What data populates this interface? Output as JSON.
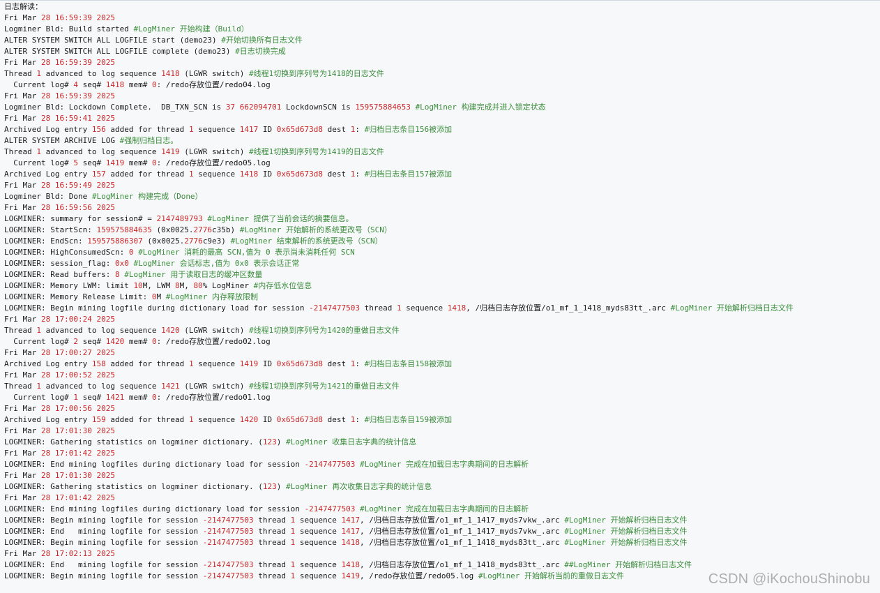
{
  "colors": {
    "background": "#f6f8fa",
    "text": "#1a1a1a",
    "number": "#c82829",
    "comment": "#3b8d3b"
  },
  "code": {
    "lines": [
      [
        {
          "t": "日志解读："
        }
      ],
      [
        {
          "t": "Fri Mar "
        },
        {
          "t": "28",
          "k": "n"
        },
        {
          "t": " "
        },
        {
          "t": "16:59:39 2025",
          "k": "n"
        }
      ],
      [
        {
          "t": "Logminer Bld: Build started "
        },
        {
          "t": "#LogMiner 开始构建（Build）",
          "k": "c"
        }
      ],
      [
        {
          "t": "ALTER SYSTEM SWITCH ALL LOGFILE start (demo23) "
        },
        {
          "t": "#开始切换所有日志文件",
          "k": "c"
        }
      ],
      [
        {
          "t": "ALTER SYSTEM SWITCH ALL LOGFILE complete (demo23) "
        },
        {
          "t": "#日志切换完成",
          "k": "c"
        }
      ],
      [
        {
          "t": "Fri Mar "
        },
        {
          "t": "28",
          "k": "n"
        },
        {
          "t": " "
        },
        {
          "t": "16:59:39 2025",
          "k": "n"
        }
      ],
      [
        {
          "t": "Thread "
        },
        {
          "t": "1",
          "k": "n"
        },
        {
          "t": " advanced to log sequence "
        },
        {
          "t": "1418",
          "k": "n"
        },
        {
          "t": " (LGWR switch) "
        },
        {
          "t": "#线程1切换到序列号为1418的日志文件",
          "k": "c"
        }
      ],
      [
        {
          "t": "  Current log# "
        },
        {
          "t": "4",
          "k": "n"
        },
        {
          "t": " seq# "
        },
        {
          "t": "1418",
          "k": "n"
        },
        {
          "t": " mem# "
        },
        {
          "t": "0",
          "k": "n"
        },
        {
          "t": ": /redo存放位置/redo04.log"
        }
      ],
      [
        {
          "t": "Fri Mar "
        },
        {
          "t": "28",
          "k": "n"
        },
        {
          "t": " "
        },
        {
          "t": "16:59:39 2025",
          "k": "n"
        }
      ],
      [
        {
          "t": "Logminer Bld: Lockdown Complete.  DB_TXN_SCN is "
        },
        {
          "t": "37",
          "k": "n"
        },
        {
          "t": " "
        },
        {
          "t": "662094701",
          "k": "n"
        },
        {
          "t": " LockdownSCN is "
        },
        {
          "t": "159575884653",
          "k": "n"
        },
        {
          "t": " "
        },
        {
          "t": "#LogMiner 构建完成并进入锁定状态",
          "k": "c"
        }
      ],
      [
        {
          "t": "Fri Mar "
        },
        {
          "t": "28",
          "k": "n"
        },
        {
          "t": " "
        },
        {
          "t": "16:59:41 2025",
          "k": "n"
        }
      ],
      [
        {
          "t": "Archived Log entry "
        },
        {
          "t": "156",
          "k": "n"
        },
        {
          "t": " added for thread "
        },
        {
          "t": "1",
          "k": "n"
        },
        {
          "t": " sequence "
        },
        {
          "t": "1417",
          "k": "n"
        },
        {
          "t": " ID "
        },
        {
          "t": "0x65d673d8",
          "k": "n"
        },
        {
          "t": " dest "
        },
        {
          "t": "1",
          "k": "n"
        },
        {
          "t": ": "
        },
        {
          "t": "#归档日志条目156被添加",
          "k": "c"
        }
      ],
      [
        {
          "t": "ALTER SYSTEM ARCHIVE LOG "
        },
        {
          "t": "#强制归档日志。",
          "k": "c"
        }
      ],
      [
        {
          "t": "Thread "
        },
        {
          "t": "1",
          "k": "n"
        },
        {
          "t": " advanced to log sequence "
        },
        {
          "t": "1419",
          "k": "n"
        },
        {
          "t": " (LGWR switch) "
        },
        {
          "t": "#线程1切换到序列号为1419的日志文件",
          "k": "c"
        }
      ],
      [
        {
          "t": "  Current log# "
        },
        {
          "t": "5",
          "k": "n"
        },
        {
          "t": " seq# "
        },
        {
          "t": "1419",
          "k": "n"
        },
        {
          "t": " mem# "
        },
        {
          "t": "0",
          "k": "n"
        },
        {
          "t": ": /redo存放位置/redo05.log"
        }
      ],
      [
        {
          "t": "Archived Log entry "
        },
        {
          "t": "157",
          "k": "n"
        },
        {
          "t": " added for thread "
        },
        {
          "t": "1",
          "k": "n"
        },
        {
          "t": " sequence "
        },
        {
          "t": "1418",
          "k": "n"
        },
        {
          "t": " ID "
        },
        {
          "t": "0x65d673d8",
          "k": "n"
        },
        {
          "t": " dest "
        },
        {
          "t": "1",
          "k": "n"
        },
        {
          "t": ": "
        },
        {
          "t": "#归档日志条目157被添加",
          "k": "c"
        }
      ],
      [
        {
          "t": "Fri Mar "
        },
        {
          "t": "28",
          "k": "n"
        },
        {
          "t": " "
        },
        {
          "t": "16:59:49 2025",
          "k": "n"
        }
      ],
      [
        {
          "t": "Logminer Bld: Done "
        },
        {
          "t": "#LogMiner 构建完成（Done）",
          "k": "c"
        }
      ],
      [
        {
          "t": "Fri Mar "
        },
        {
          "t": "28",
          "k": "n"
        },
        {
          "t": " "
        },
        {
          "t": "16:59:56 2025",
          "k": "n"
        }
      ],
      [
        {
          "t": "LOGMINER: summary for session# = "
        },
        {
          "t": "2147489793",
          "k": "n"
        },
        {
          "t": " "
        },
        {
          "t": "#LogMiner 提供了当前会话的摘要信息。",
          "k": "c"
        }
      ],
      [
        {
          "t": "LOGMINER: StartScn: "
        },
        {
          "t": "159575884635",
          "k": "n"
        },
        {
          "t": " (0x0025."
        },
        {
          "t": "2776",
          "k": "n"
        },
        {
          "t": "c35b) "
        },
        {
          "t": "#LogMiner 开始解析的系统更改号（SCN）",
          "k": "c"
        }
      ],
      [
        {
          "t": "LOGMINER: EndScn: "
        },
        {
          "t": "159575886307",
          "k": "n"
        },
        {
          "t": " (0x0025."
        },
        {
          "t": "2776",
          "k": "n"
        },
        {
          "t": "c9e3) "
        },
        {
          "t": "#LogMiner 结束解析的系统更改号（SCN）",
          "k": "c"
        }
      ],
      [
        {
          "t": "LOGMINER: HighConsumedScn: "
        },
        {
          "t": "0",
          "k": "n"
        },
        {
          "t": " "
        },
        {
          "t": "#LogMiner 消耗的最高 SCN,值为 0 表示尚未消耗任何 SCN",
          "k": "c"
        }
      ],
      [
        {
          "t": "LOGMINER: session_flag: "
        },
        {
          "t": "0x0",
          "k": "n"
        },
        {
          "t": " "
        },
        {
          "t": "#LogMiner 会话标志,值为 0x0 表示会话正常",
          "k": "c"
        }
      ],
      [
        {
          "t": "LOGMINER: Read buffers: "
        },
        {
          "t": "8",
          "k": "n"
        },
        {
          "t": " "
        },
        {
          "t": "#LogMiner 用于读取日志的缓冲区数量",
          "k": "c"
        }
      ],
      [
        {
          "t": "LOGMINER: Memory LWM: limit "
        },
        {
          "t": "10",
          "k": "n"
        },
        {
          "t": "M, LWM "
        },
        {
          "t": "8",
          "k": "n"
        },
        {
          "t": "M, "
        },
        {
          "t": "80",
          "k": "n"
        },
        {
          "t": "% LogMiner "
        },
        {
          "t": "#内存低水位信息",
          "k": "c"
        }
      ],
      [
        {
          "t": "LOGMINER: Memory Release Limit: "
        },
        {
          "t": "0",
          "k": "n"
        },
        {
          "t": "M "
        },
        {
          "t": "#LogMiner 内存释放限制",
          "k": "c"
        }
      ],
      [
        {
          "t": "LOGMINER: Begin mining logfile during dictionary load for session "
        },
        {
          "t": "-2147477503",
          "k": "n"
        },
        {
          "t": " thread "
        },
        {
          "t": "1",
          "k": "n"
        },
        {
          "t": " sequence "
        },
        {
          "t": "1418",
          "k": "n"
        },
        {
          "t": ", /归档日志存放位置/o1_mf_1_1418_myds83tt_.arc "
        },
        {
          "t": "#LogMiner 开始解析归档日志文件",
          "k": "c"
        }
      ],
      [
        {
          "t": "Fri Mar "
        },
        {
          "t": "28",
          "k": "n"
        },
        {
          "t": " "
        },
        {
          "t": "17:00:24 2025",
          "k": "n"
        }
      ],
      [
        {
          "t": "Thread "
        },
        {
          "t": "1",
          "k": "n"
        },
        {
          "t": " advanced to log sequence "
        },
        {
          "t": "1420",
          "k": "n"
        },
        {
          "t": " (LGWR switch) "
        },
        {
          "t": "#线程1切换到序列号为1420的重做日志文件",
          "k": "c"
        }
      ],
      [
        {
          "t": "  Current log# "
        },
        {
          "t": "2",
          "k": "n"
        },
        {
          "t": " seq# "
        },
        {
          "t": "1420",
          "k": "n"
        },
        {
          "t": " mem# "
        },
        {
          "t": "0",
          "k": "n"
        },
        {
          "t": ": /redo存放位置/redo02.log"
        }
      ],
      [
        {
          "t": "Fri Mar "
        },
        {
          "t": "28",
          "k": "n"
        },
        {
          "t": " "
        },
        {
          "t": "17:00:27 2025",
          "k": "n"
        }
      ],
      [
        {
          "t": "Archived Log entry "
        },
        {
          "t": "158",
          "k": "n"
        },
        {
          "t": " added for thread "
        },
        {
          "t": "1",
          "k": "n"
        },
        {
          "t": " sequence "
        },
        {
          "t": "1419",
          "k": "n"
        },
        {
          "t": " ID "
        },
        {
          "t": "0x65d673d8",
          "k": "n"
        },
        {
          "t": " dest "
        },
        {
          "t": "1",
          "k": "n"
        },
        {
          "t": ": "
        },
        {
          "t": "#归档日志条目158被添加",
          "k": "c"
        }
      ],
      [
        {
          "t": "Fri Mar "
        },
        {
          "t": "28",
          "k": "n"
        },
        {
          "t": " "
        },
        {
          "t": "17:00:52 2025",
          "k": "n"
        }
      ],
      [
        {
          "t": "Thread "
        },
        {
          "t": "1",
          "k": "n"
        },
        {
          "t": " advanced to log sequence "
        },
        {
          "t": "1421",
          "k": "n"
        },
        {
          "t": " (LGWR switch) "
        },
        {
          "t": "#线程1切换到序列号为1421的重做日志文件",
          "k": "c"
        }
      ],
      [
        {
          "t": "  Current log# "
        },
        {
          "t": "1",
          "k": "n"
        },
        {
          "t": " seq# "
        },
        {
          "t": "1421",
          "k": "n"
        },
        {
          "t": " mem# "
        },
        {
          "t": "0",
          "k": "n"
        },
        {
          "t": ": /redo存放位置/redo01.log"
        }
      ],
      [
        {
          "t": "Fri Mar "
        },
        {
          "t": "28",
          "k": "n"
        },
        {
          "t": " "
        },
        {
          "t": "17:00:56 2025",
          "k": "n"
        }
      ],
      [
        {
          "t": "Archived Log entry "
        },
        {
          "t": "159",
          "k": "n"
        },
        {
          "t": " added for thread "
        },
        {
          "t": "1",
          "k": "n"
        },
        {
          "t": " sequence "
        },
        {
          "t": "1420",
          "k": "n"
        },
        {
          "t": " ID "
        },
        {
          "t": "0x65d673d8",
          "k": "n"
        },
        {
          "t": " dest "
        },
        {
          "t": "1",
          "k": "n"
        },
        {
          "t": ": "
        },
        {
          "t": "#归档日志条目159被添加",
          "k": "c"
        }
      ],
      [
        {
          "t": "Fri Mar "
        },
        {
          "t": "28",
          "k": "n"
        },
        {
          "t": " "
        },
        {
          "t": "17:01:30 2025",
          "k": "n"
        }
      ],
      [
        {
          "t": "LOGMINER: Gathering statistics on logminer dictionary. ("
        },
        {
          "t": "123",
          "k": "n"
        },
        {
          "t": ") "
        },
        {
          "t": "#LogMiner 收集日志字典的统计信息",
          "k": "c"
        }
      ],
      [
        {
          "t": "Fri Mar "
        },
        {
          "t": "28",
          "k": "n"
        },
        {
          "t": " "
        },
        {
          "t": "17:01:42 2025",
          "k": "n"
        }
      ],
      [
        {
          "t": "LOGMINER: End mining logfiles during dictionary load for session "
        },
        {
          "t": "-2147477503",
          "k": "n"
        },
        {
          "t": " "
        },
        {
          "t": "#LogMiner 完成在加载日志字典期间的日志解析",
          "k": "c"
        }
      ],
      [
        {
          "t": "Fri Mar "
        },
        {
          "t": "28",
          "k": "n"
        },
        {
          "t": " "
        },
        {
          "t": "17:01:30 2025",
          "k": "n"
        }
      ],
      [
        {
          "t": "LOGMINER: Gathering statistics on logminer dictionary. ("
        },
        {
          "t": "123",
          "k": "n"
        },
        {
          "t": ") "
        },
        {
          "t": "#LogMiner 再次收集日志字典的统计信息",
          "k": "c"
        }
      ],
      [
        {
          "t": "Fri Mar "
        },
        {
          "t": "28",
          "k": "n"
        },
        {
          "t": " "
        },
        {
          "t": "17:01:42 2025",
          "k": "n"
        }
      ],
      [
        {
          "t": "LOGMINER: End mining logfiles during dictionary load for session "
        },
        {
          "t": "-2147477503",
          "k": "n"
        },
        {
          "t": " "
        },
        {
          "t": "#LogMiner 完成在加载日志字典期间的日志解析",
          "k": "c"
        }
      ],
      [
        {
          "t": "LOGMINER: Begin mining logfile for session "
        },
        {
          "t": "-2147477503",
          "k": "n"
        },
        {
          "t": " thread "
        },
        {
          "t": "1",
          "k": "n"
        },
        {
          "t": " sequence "
        },
        {
          "t": "1417",
          "k": "n"
        },
        {
          "t": ", /归档日志存放位置/o1_mf_1_1417_myds7vkw_.arc "
        },
        {
          "t": "#LogMiner 开始解析归档日志文件",
          "k": "c"
        }
      ],
      [
        {
          "t": "LOGMINER: End   mining logfile for session "
        },
        {
          "t": "-2147477503",
          "k": "n"
        },
        {
          "t": " thread "
        },
        {
          "t": "1",
          "k": "n"
        },
        {
          "t": " sequence "
        },
        {
          "t": "1417",
          "k": "n"
        },
        {
          "t": ", /归档日志存放位置/o1_mf_1_1417_myds7vkw_.arc "
        },
        {
          "t": "#LogMiner 开始解析归档日志文件",
          "k": "c"
        }
      ],
      [
        {
          "t": "LOGMINER: Begin mining logfile for session "
        },
        {
          "t": "-2147477503",
          "k": "n"
        },
        {
          "t": " thread "
        },
        {
          "t": "1",
          "k": "n"
        },
        {
          "t": " sequence "
        },
        {
          "t": "1418",
          "k": "n"
        },
        {
          "t": ", /归档日志存放位置/o1_mf_1_1418_myds83tt_.arc "
        },
        {
          "t": "#LogMiner 开始解析归档日志文件",
          "k": "c"
        }
      ],
      [
        {
          "t": "Fri Mar "
        },
        {
          "t": "28",
          "k": "n"
        },
        {
          "t": " "
        },
        {
          "t": "17:02:13 2025",
          "k": "n"
        }
      ],
      [
        {
          "t": "LOGMINER: End   mining logfile for session "
        },
        {
          "t": "-2147477503",
          "k": "n"
        },
        {
          "t": " thread "
        },
        {
          "t": "1",
          "k": "n"
        },
        {
          "t": " sequence "
        },
        {
          "t": "1418",
          "k": "n"
        },
        {
          "t": ", /归档日志存放位置/o1_mf_1_1418_myds83tt_.arc "
        },
        {
          "t": "##LogMiner 开始解析归档日志文件",
          "k": "c"
        }
      ],
      [
        {
          "t": "LOGMINER: Begin mining logfile for session "
        },
        {
          "t": "-2147477503",
          "k": "n"
        },
        {
          "t": " thread "
        },
        {
          "t": "1",
          "k": "n"
        },
        {
          "t": " sequence "
        },
        {
          "t": "1419",
          "k": "n"
        },
        {
          "t": ", /redo存放位置/redo05.log "
        },
        {
          "t": "#LogMiner 开始解析当前的重做日志文件",
          "k": "c"
        }
      ]
    ]
  },
  "watermark": "CSDN @iKochouShinobu"
}
